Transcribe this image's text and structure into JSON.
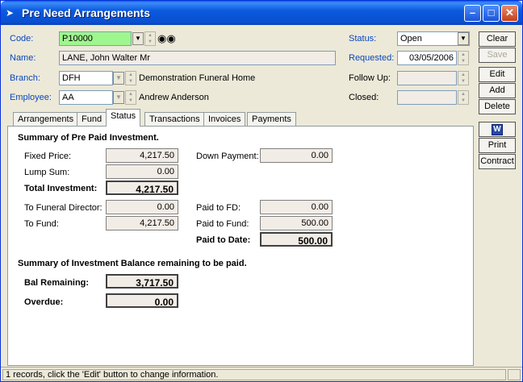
{
  "window": {
    "title": "Pre Need Arrangements"
  },
  "form": {
    "code_label": "Code:",
    "code_value": "P10000",
    "name_label": "Name:",
    "name_value": "LANE, John Walter Mr",
    "branch_label": "Branch:",
    "branch_code": "DFH",
    "branch_name": "Demonstration Funeral Home",
    "employee_label": "Employee:",
    "employee_code": "AA",
    "employee_name": "Andrew Anderson",
    "status_label": "Status:",
    "status_value": "Open",
    "requested_label": "Requested:",
    "requested_value": "03/05/2006",
    "followup_label": "Follow Up:",
    "followup_value": "",
    "closed_label": "Closed:",
    "closed_value": ""
  },
  "buttons": {
    "clear": "Clear",
    "save": "Save",
    "edit": "Edit",
    "add": "Add",
    "delete": "Delete",
    "print": "Print",
    "contract": "Contract",
    "word_glyph": "W"
  },
  "tabs": [
    "Arrangements",
    "Fund",
    "Status",
    "Transactions",
    "Invoices",
    "Payments"
  ],
  "active_tab": "Status",
  "summary": {
    "title": "Summary of Pre Paid Investment.",
    "fixed_price_label": "Fixed Price:",
    "fixed_price": "4,217.50",
    "lump_sum_label": "Lump Sum:",
    "lump_sum": "0.00",
    "total_investment_label": "Total Investment:",
    "total_investment": "4,217.50",
    "down_payment_label": "Down Payment:",
    "down_payment": "0.00",
    "to_fd_label": "To Funeral Director:",
    "to_fd": "0.00",
    "to_fund_label": "To Fund:",
    "to_fund": "4,217.50",
    "paid_fd_label": "Paid to FD:",
    "paid_fd": "0.00",
    "paid_fund_label": "Paid to Fund:",
    "paid_fund": "500.00",
    "paid_date_label": "Paid to Date:",
    "paid_date": "500.00"
  },
  "balance": {
    "title": "Summary of Investment Balance remaining to be paid.",
    "remaining_label": "Bal Remaining:",
    "remaining": "3,717.50",
    "overdue_label": "Overdue:",
    "overdue": "0.00"
  },
  "statusbar": {
    "message": "1 records, click the 'Edit' button to change information."
  }
}
